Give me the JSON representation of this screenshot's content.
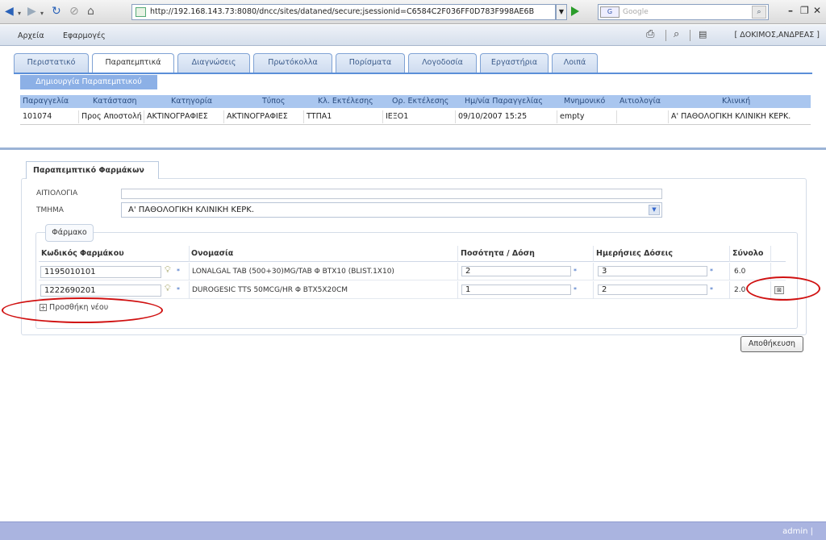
{
  "browser": {
    "url": "http://192.168.143.73:8080/dncc/sites/dataned/secure;jsessionid=C6584C2F036FF0D783F998AE6B",
    "search_placeholder": "Google",
    "google_label": "G"
  },
  "header": {
    "menu": [
      "Αρχεία",
      "Εφαρμογές"
    ],
    "user": "[ ΔΟΚΙΜΟΣ,ΑΝΔΡΕΑΣ ]"
  },
  "tabs": [
    "Περιστατικό",
    "Παραπεμπτικά",
    "Διαγνώσεις",
    "Πρωτόκολλα",
    "Πορίσματα",
    "Λογοδοσία",
    "Εργαστήρια",
    "Λοιπά"
  ],
  "active_tab": 1,
  "create_button": "Δημιουργία Παραπεμπτικού",
  "grid": {
    "headers": [
      "Παραγγελία",
      "Κατάσταση",
      "Κατηγορία",
      "Τύπος",
      "Κλ. Εκτέλεσης",
      "Ορ. Εκτέλεσης",
      "Ημ/νία Παραγγελίας",
      "Μνημονικό",
      "Αιτιολογία",
      "Κλινική"
    ],
    "rows": [
      [
        "101074",
        "Προς Αποστολή",
        "ΑΚΤΙΝΟΓΡΑΦΙΕΣ",
        "ΑΚΤΙΝΟΓΡΑΦΙΕΣ",
        "ΤΤΠΑ1",
        "ΙΕΞΟ1",
        "09/10/2007 15:25",
        "empty",
        "",
        "Α' ΠΑΘΟΛΟΓΙΚΗ ΚΛΙΝΙΚΗ ΚΕΡΚ."
      ]
    ]
  },
  "form": {
    "tab_label": "Παραπεμπτικό Φαρμάκων",
    "reason_label": "ΑΙΤΙΟΛΟΓΙΑ",
    "reason_value": "",
    "dept_label": "ΤΜΗΜΑ",
    "dept_value": "Α' ΠΑΘΟΛΟΓΙΚΗ ΚΛΙΝΙΚΗ ΚΕΡΚ.",
    "drug_group_label": "Φάρμακο",
    "drug_headers": [
      "Κωδικός Φαρμάκου",
      "Ονομασία",
      "Ποσότητα / Δόση",
      "Ημερήσιες Δόσεις",
      "Σύνολο"
    ],
    "drugs": [
      {
        "code": "1195010101",
        "name": "LONALGAL TAB (500+30)MG/TAB Φ BTX10 (BLIST.1X10)",
        "qty": "2",
        "daily": "3",
        "total": "6.0"
      },
      {
        "code": "1222690201",
        "name": "DUROGESIC TTS 50MCG/HR Φ BTX5X20CM",
        "qty": "1",
        "daily": "2",
        "total": "2.0"
      }
    ],
    "add_new": "Προσθήκη νέου",
    "save": "Αποθήκευση"
  },
  "status_user": "admin |",
  "colors": {
    "tab_strip": "#5b8fd8",
    "annotation": "#d01010",
    "status_bar": "#aab4e0"
  }
}
